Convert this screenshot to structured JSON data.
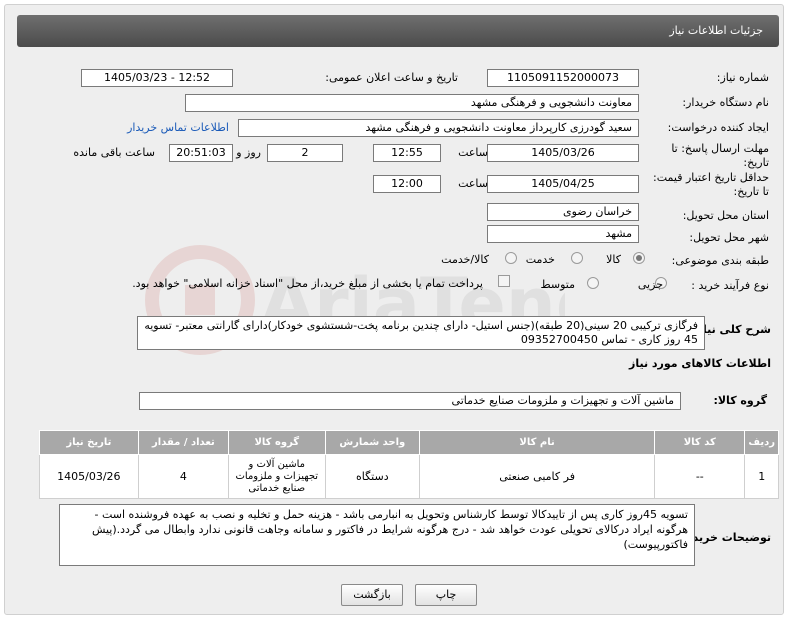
{
  "header": {
    "title": "جزئیات اطلاعات نیاز"
  },
  "need_number": {
    "label": "شماره نیاز:",
    "value": "1105091152000073"
  },
  "announce_datetime": {
    "label": "تاریخ و ساعت اعلان عمومی:",
    "value": "1405/03/23 - 12:52"
  },
  "buyer_org": {
    "label": "نام دستگاه خریدار:",
    "value": "معاونت دانشجویی و فرهنگی مشهد"
  },
  "requester": {
    "label": "ایجاد کننده درخواست:",
    "value": "سعید گودرزی کارپرداز معاونت دانشجویی و فرهنگی مشهد",
    "contact_link": "اطلاعات تماس خریدار"
  },
  "reply_deadline": {
    "label_line1": "مهلت ارسال پاسخ: تا",
    "label_line2": "تاریخ:",
    "date": "1405/03/26",
    "time_label": "ساعت",
    "time": "12:55",
    "days": "2",
    "days_label": "روز و",
    "remaining": "20:51:03",
    "remaining_label": "ساعت باقی مانده"
  },
  "price_validity": {
    "label_line1": "حداقل تاریخ اعتبار قیمت:",
    "label_line2": "تا تاریخ:",
    "date": "1405/04/25",
    "time_label": "ساعت",
    "time": "12:00"
  },
  "delivery_province": {
    "label": "استان محل تحویل:",
    "value": "خراسان رضوی"
  },
  "delivery_city": {
    "label": "شهر محل تحویل:",
    "value": "مشهد"
  },
  "category": {
    "label": "طبقه بندی موضوعی:",
    "options": [
      "کالا",
      "خدمت",
      "کالا/خدمت"
    ],
    "selected": "کالا"
  },
  "purchase_process": {
    "label": "نوع فرآیند خرید :",
    "options": [
      "جزیی",
      "متوسط"
    ],
    "selected": "",
    "payment_note": "پرداخت تمام یا بخشی از مبلغ خرید،از محل \"اسناد خزانه اسلامی\" خواهد بود."
  },
  "general_description": {
    "label": "شرح کلی نیاز:",
    "value": "فرگازی ترکیبی 20 سینی(20 طبقه)(جنس استیل- دارای چندین برنامه پخت-شستشوی خودکار)دارای گارانتی معتبر- تسویه 45 روز کاری - تماس 09352700450"
  },
  "items_section": {
    "title": "اطلاعات کالاهای مورد نیاز"
  },
  "goods_group": {
    "label": "گروه کالا:",
    "value": "ماشین آلات و تجهیزات و ملزومات صنایع خدماتی"
  },
  "items_table": {
    "headers": [
      "ردیف",
      "کد کالا",
      "نام کالا",
      "واحد شمارش",
      "گروه کالا",
      "تعداد / مقدار",
      "تاریخ نیاز"
    ],
    "rows": [
      [
        "1",
        "--",
        "فر کامبی صنعتی",
        "دستگاه",
        "ماشین آلات و تجهیزات و ملزومات صنایع خدماتی",
        "4",
        "1405/03/26"
      ]
    ]
  },
  "buyer_notes": {
    "label": "توضیحات خریدار:",
    "value": "تسویه 45روز کاری پس از تاییدکالا توسط کارشناس وتحویل به انبارمی باشد - هزینه حمل و تخلیه و نصب به عهده فروشنده است - هرگونه ایراد درکالای تحویلی عودت خواهد شد - درج هرگونه شرایط در فاکتور و سامانه وجاهت قانونی ندارد وابطال می گردد.(پیش فاکتورپیوست)"
  },
  "buttons": {
    "print": "چاپ",
    "back": "بازگشت"
  }
}
